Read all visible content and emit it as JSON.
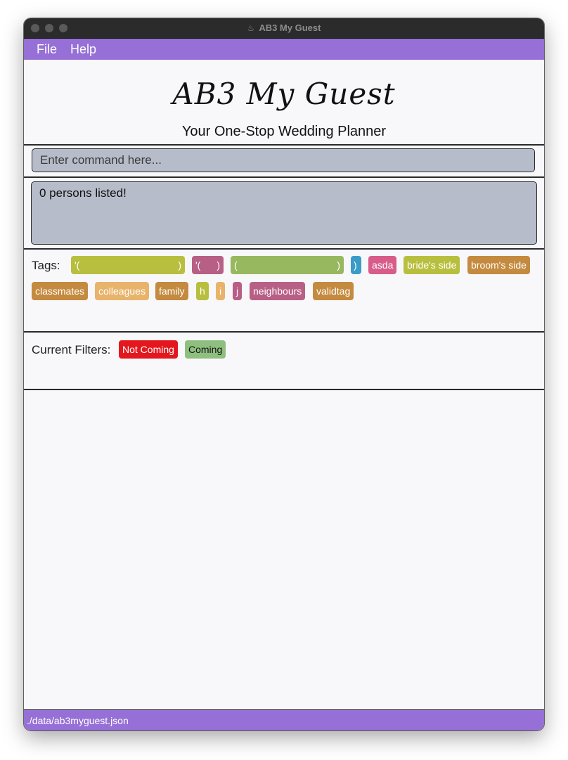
{
  "window": {
    "title": "AB3 My Guest",
    "title_icon": "java-icon"
  },
  "menu": {
    "items": [
      {
        "label": "File"
      },
      {
        "label": "Help"
      }
    ]
  },
  "header": {
    "title": "AB3 My Guest",
    "subtitle": "Your One-Stop Wedding Planner"
  },
  "command": {
    "placeholder": "Enter command here...",
    "value": ""
  },
  "result": {
    "text": "0 persons listed!"
  },
  "tags": {
    "label": "Tags:",
    "items": [
      {
        "label": "'(",
        "end": ")",
        "color": "#b8bf3f"
      },
      {
        "label": "'(",
        "end": ")",
        "color": "#b85f86"
      },
      {
        "label": "(",
        "end": ")",
        "color": "#97b85f"
      },
      {
        "label": ")",
        "end": "",
        "color": "#3b9bc7"
      },
      {
        "label": "asda",
        "end": "",
        "color": "#d85c8a"
      },
      {
        "label": "bride's side",
        "end": "",
        "color": "#b8bf3f"
      },
      {
        "label": "broom's side",
        "end": "",
        "color": "#c48a3f"
      },
      {
        "label": "classmates",
        "end": "",
        "color": "#c48a3f"
      },
      {
        "label": "colleagues",
        "end": "",
        "color": "#e8b36a"
      },
      {
        "label": "family",
        "end": "",
        "color": "#c48a3f"
      },
      {
        "label": "h",
        "end": "",
        "color": "#b8bf3f"
      },
      {
        "label": "i",
        "end": "",
        "color": "#e8b36a"
      },
      {
        "label": "j",
        "end": "",
        "color": "#b85f86"
      },
      {
        "label": "neighbours",
        "end": "",
        "color": "#b85f86"
      },
      {
        "label": "validtag",
        "end": "",
        "color": "#c48a3f"
      }
    ]
  },
  "filters": {
    "label": "Current Filters:",
    "items": [
      {
        "label": "Not Coming",
        "color": "#e3181e",
        "text_color": "#ffffff"
      },
      {
        "label": "Coming",
        "color": "#8fbf7f",
        "text_color": "#111111"
      }
    ]
  },
  "status": {
    "path": "./data/ab3myguest.json"
  }
}
